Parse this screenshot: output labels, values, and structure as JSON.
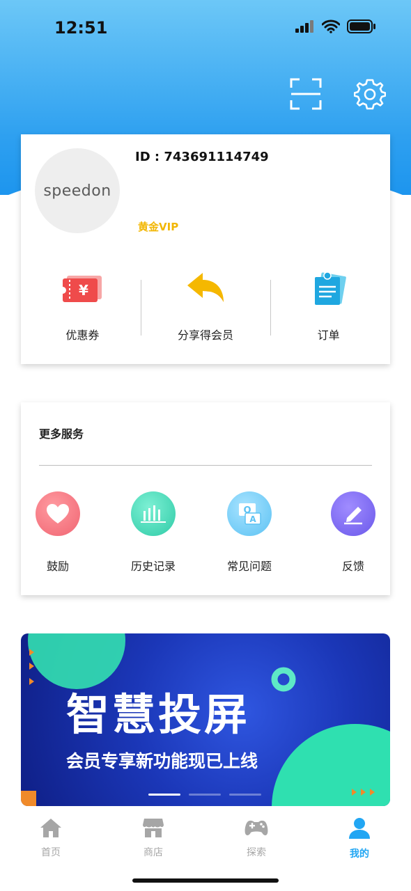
{
  "status_bar": {
    "time": "12:51"
  },
  "profile": {
    "avatar_logo_text": "speedon",
    "user_id": "ID : 743691114749",
    "vip_level": "黄金VIP"
  },
  "quick_actions": [
    {
      "label": "优惠券",
      "icon": "coupon-icon"
    },
    {
      "label": "分享得会员",
      "icon": "share-icon"
    },
    {
      "label": "订单",
      "icon": "order-icon"
    }
  ],
  "services": {
    "title": "更多服务",
    "items": [
      {
        "label": "鼓励",
        "icon": "heart-icon"
      },
      {
        "label": "历史记录",
        "icon": "history-chart-icon"
      },
      {
        "label": "常见问题",
        "icon": "faq-icon"
      },
      {
        "label": "反馈",
        "icon": "feedback-pencil-icon"
      }
    ]
  },
  "banner": {
    "title": "智慧投屏",
    "subtitle": "会员专享新功能现已上线",
    "active_slide": 1,
    "slide_count": 3
  },
  "tabbar": {
    "tabs": [
      {
        "label": "首页",
        "icon": "home-icon"
      },
      {
        "label": "商店",
        "icon": "store-icon"
      },
      {
        "label": "探索",
        "icon": "gamepad-icon"
      },
      {
        "label": "我的",
        "icon": "profile-icon",
        "active": true
      }
    ]
  },
  "colors": {
    "header_gradient_top": "#6cc7f7",
    "header_gradient_bottom": "#1d95ee",
    "vip_gold": "#f2b705",
    "active_tab": "#21a6f3",
    "inactive_tab": "#a6a6a6"
  }
}
